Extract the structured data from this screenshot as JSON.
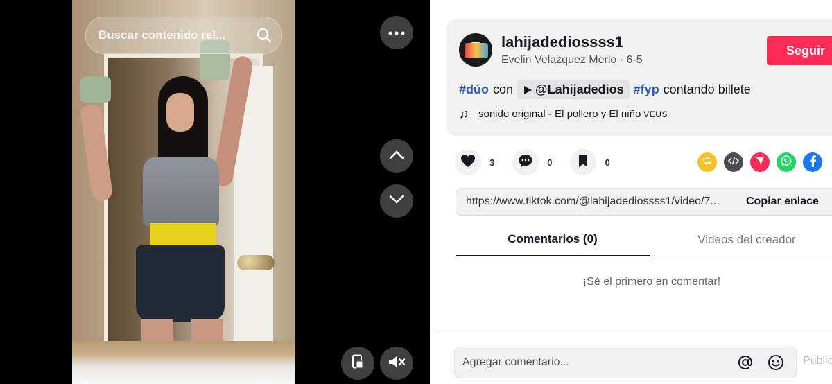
{
  "video": {
    "search_placeholder": "Buscar contenido rel...",
    "icons": {
      "search": "search-icon",
      "more": "ellipsis-icon",
      "prev": "chevron-up-icon",
      "next": "chevron-down-icon",
      "pip": "floating-player-icon",
      "mute": "volume-muted-icon"
    }
  },
  "post": {
    "username": "lahijadediossss1",
    "display_name": "Evelin Velazquez Merlo",
    "separator": " · ",
    "date": "6-5",
    "follow_label": "Seguir",
    "description": {
      "tag1": "#dúo",
      "con": "con",
      "mention": "@Lahijadedios",
      "tag2": "#fyp",
      "text": "contando billete"
    },
    "music": {
      "title": "sonido original - El pollero y El niño",
      "suffix": "VEUS"
    }
  },
  "actions": {
    "likes": "3",
    "comments": "0",
    "saves": "0"
  },
  "share": {
    "icons": [
      "repost-icon",
      "embed-icon",
      "send-icon",
      "whatsapp-icon",
      "facebook-icon"
    ],
    "colors": {
      "repost": "#f6c223",
      "embed": "#4b4d54",
      "send": "#fe2c55",
      "whatsapp": "#25d366",
      "facebook": "#1877f2"
    }
  },
  "link": {
    "url": "https://www.tiktok.com/@lahijadediossss1/video/7...",
    "copy_label": "Copiar enlace"
  },
  "tabs": [
    {
      "label": "Comentarios (0)",
      "active": true
    },
    {
      "label": "Videos del creador",
      "active": false
    }
  ],
  "comments": {
    "empty_text": "¡Sé el primero en comentar!",
    "input_placeholder": "Agregar comentario...",
    "post_label": "Publicar"
  },
  "colors": {
    "accent": "#fe2c55",
    "hashtag": "#2b5db9"
  }
}
